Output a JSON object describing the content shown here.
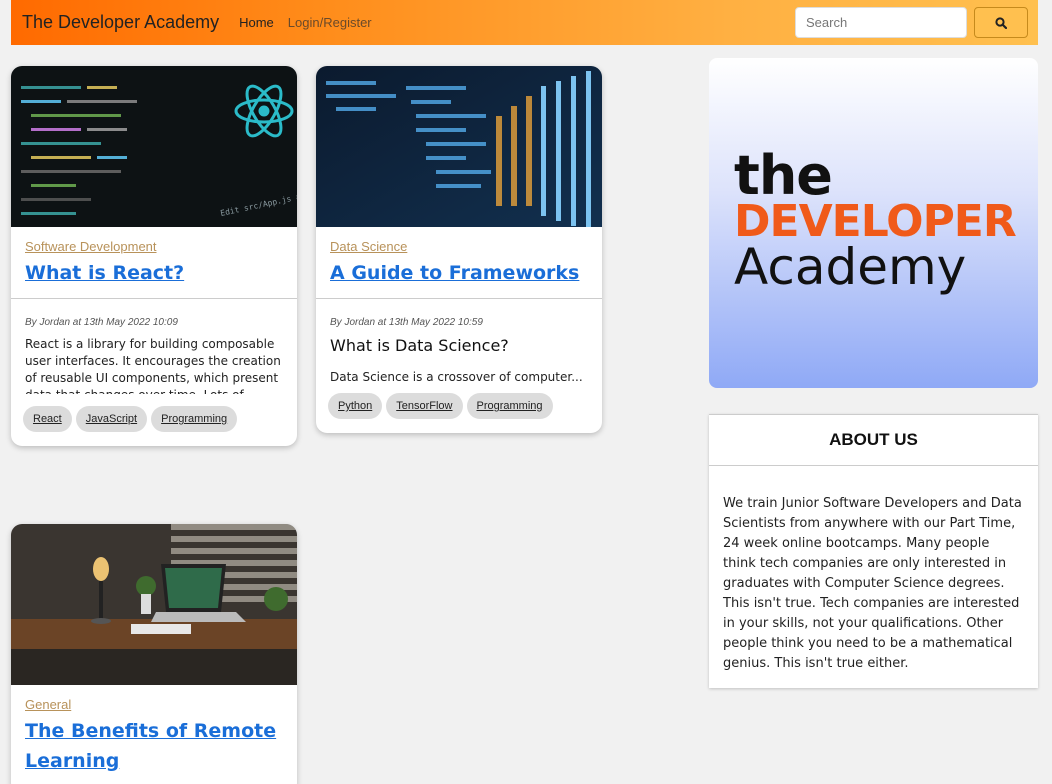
{
  "navbar": {
    "brand": "The Developer Academy",
    "links": [
      "Home",
      "Login/Register"
    ],
    "search_placeholder": "Search",
    "accent": "#ffc04f"
  },
  "posts": [
    {
      "category": "Software Development",
      "title": "What is React?",
      "meta": "By Jordan at 13th May 2022 10:09",
      "excerpt": "React is a library for building composable user interfaces. It encourages the creation of reusable UI components, which present data that changes over time. Lots of people use",
      "tags": [
        "React",
        "JavaScript",
        "Programming"
      ]
    },
    {
      "category": "Data Science",
      "title": "A Guide to Frameworks",
      "meta": "By Jordan at 13th May 2022 10:59",
      "subheading": "What is Data Science?",
      "excerpt": "Data Science is a crossover of computer...",
      "tags": [
        "Python",
        "TensorFlow",
        "Programming"
      ]
    },
    {
      "category": "General",
      "title": "The Benefits of Remote Learning"
    }
  ],
  "sidebar": {
    "logo": {
      "line1": "the",
      "line2": "DEVELOPER",
      "line3": "Academy"
    },
    "about_title": "ABOUT US",
    "about_text": "We train Junior Software Developers and Data Scientists from anywhere with our Part Time, 24 week online bootcamps. Many people think tech companies are only interested in graduates with Computer Science degrees. This isn't true. Tech companies are interested in your skills, not your qualifications. Other people think you need to be a mathematical genius. This isn't true either."
  }
}
